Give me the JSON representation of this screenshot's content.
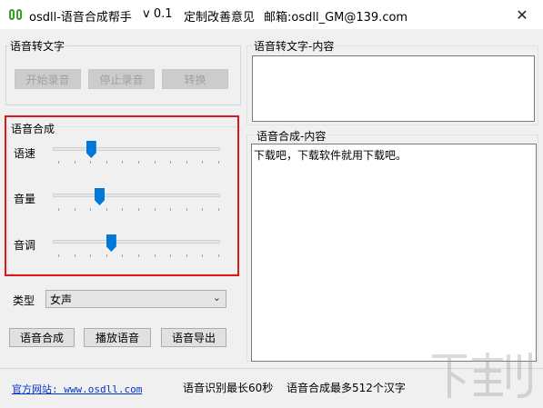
{
  "window": {
    "title": "osdll-语音合成帮手",
    "version": "v 0.1",
    "custom_link": "定制改善意见",
    "email_label": "邮箱:osdll_GM@139.com",
    "close_symbol": "✕"
  },
  "speech_to_text": {
    "group_title": "语音转文字",
    "start_label": "开始录音",
    "stop_label": "停止录音",
    "convert_label": "转换",
    "content_title": "语音转文字-内容",
    "content_text": ""
  },
  "synthesis": {
    "group_title": "语音合成",
    "speed_label": "语速",
    "speed_value": 0.23,
    "volume_label": "音量",
    "volume_value": 0.28,
    "pitch_label": "音调",
    "pitch_value": 0.35,
    "type_label": "类型",
    "voice_selected": "女声",
    "content_title": "语音合成-内容",
    "content_text": "下载吧，下载软件就用下载吧。"
  },
  "actions": {
    "synthesize_label": "语音合成",
    "play_label": "播放语音",
    "export_label": "语音导出"
  },
  "status": {
    "website_label": "官方网站: www.osdll.com",
    "recognition_limit": "语音识别最长60秒",
    "synthesis_limit": "语音合成最多512个汉字"
  },
  "colors": {
    "accent": "#0078d7",
    "highlight_frame": "#e0161b",
    "link": "#0033cc"
  }
}
